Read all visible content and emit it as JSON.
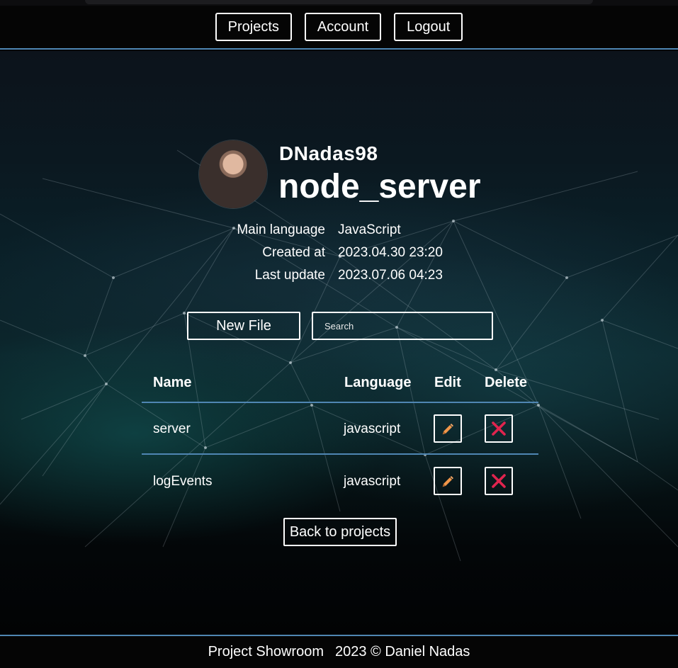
{
  "nav": {
    "projects_label": "Projects",
    "account_label": "Account",
    "logout_label": "Logout"
  },
  "profile": {
    "owner": "DNadas98",
    "project_name": "node_server"
  },
  "meta": {
    "main_language_label": "Main language",
    "main_language_value": "JavaScript",
    "created_label": "Created at",
    "created_value": "2023.04.30 23:20",
    "updated_label": "Last update",
    "updated_value": "2023.07.06 04:23"
  },
  "toolbar": {
    "new_file_label": "New File",
    "search_placeholder": "Search"
  },
  "table": {
    "headers": {
      "name": "Name",
      "language": "Language",
      "edit": "Edit",
      "delete": "Delete"
    },
    "rows": [
      {
        "name": "server",
        "language": "javascript"
      },
      {
        "name": "logEvents",
        "language": "javascript"
      }
    ]
  },
  "back_label": "Back to projects",
  "footer": {
    "app_name": "Project Showroom",
    "copyright": "2023 © Daniel Nadas"
  },
  "colors": {
    "accent_line": "#4f86b3",
    "edit_icon": "#f0964a",
    "delete_icon": "#e0244e"
  },
  "icons": {
    "edit": "pencil-icon",
    "delete": "close-icon"
  }
}
